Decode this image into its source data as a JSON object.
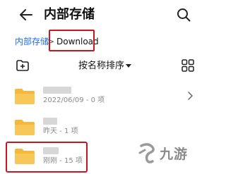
{
  "header": {
    "title": "内部存储",
    "back_icon": "arrow-left-icon",
    "search_icon": "search-icon"
  },
  "breadcrumb": {
    "root": "内部存储",
    "separator": ">",
    "current": "Download",
    "highlight_color": "#c8161d"
  },
  "toolbar": {
    "sort_label": "按名称排序",
    "new_folder_icon": "new-folder-icon",
    "view_toggle_icon": "grid-view-icon"
  },
  "folders": [
    {
      "meta": "2022/06/09 - 0 项",
      "has_chevron": true
    },
    {
      "meta": "昨天 - 1 项",
      "has_chevron": false
    },
    {
      "meta": "刚刚 - 15 项",
      "has_chevron": false,
      "highlighted": true
    }
  ],
  "colors": {
    "accent": "#1e6fd9",
    "folder": "#f5b83a",
    "highlight": "#c8161d"
  },
  "watermark": {
    "text": "九游"
  }
}
